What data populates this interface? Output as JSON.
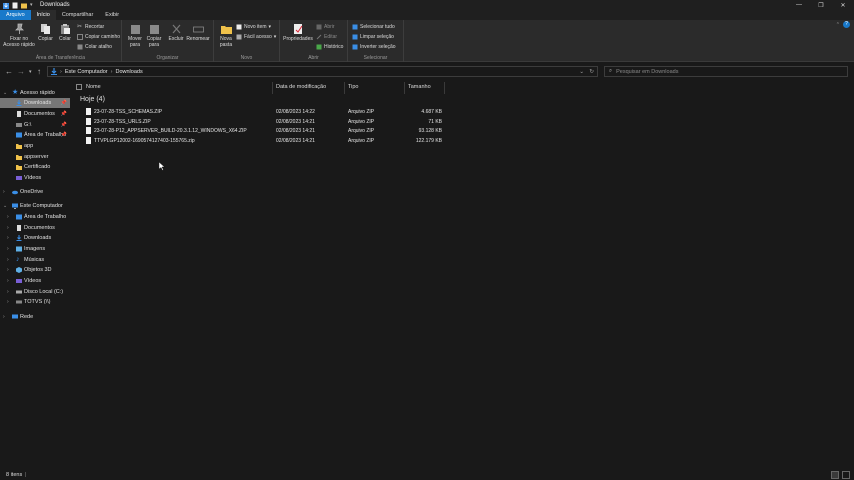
{
  "window": {
    "title": "Downloads"
  },
  "ribbon_tabs": [
    "Arquivo",
    "Início",
    "Compartilhar",
    "Exibir"
  ],
  "ribbon": {
    "clipboard": {
      "pin_label": "Fixar no Acesso rápido",
      "copy_label": "Copiar",
      "paste_label": "Colar",
      "cut_label": "Recortar",
      "copy_path_label": "Copiar caminho",
      "paste_shortcut_label": "Colar atalho",
      "group_label": "Área de Transferência"
    },
    "organize": {
      "move_label": "Mover para",
      "copy_to_label": "Copiar para",
      "delete_label": "Excluir",
      "rename_label": "Renomear",
      "group_label": "Organizar"
    },
    "new": {
      "new_folder_label": "Nova pasta",
      "new_item_label": "Novo item",
      "easy_access_label": "Fácil acesso",
      "group_label": "Novo"
    },
    "open": {
      "properties_label": "Propriedades",
      "open_label": "Abrir",
      "edit_label": "Editar",
      "history_label": "Histórico",
      "group_label": "Abrir"
    },
    "select": {
      "select_all_label": "Selecionar tudo",
      "select_none_label": "Limpar seleção",
      "invert_label": "Inverter seleção",
      "group_label": "Selecionar"
    }
  },
  "address": {
    "crumbs": [
      "Este Computador",
      "Downloads"
    ],
    "search_placeholder": "Pesquisar em Downloads"
  },
  "sidebar": {
    "quick_access": "Acesso rápido",
    "quick_items": [
      {
        "label": "Downloads",
        "pinned": true,
        "selected": true
      },
      {
        "label": "Documentos",
        "pinned": true
      },
      {
        "label": "G:\\",
        "pinned": true
      },
      {
        "label": "Área de Trabalho",
        "pinned": true
      },
      {
        "label": "app"
      },
      {
        "label": "appserver"
      },
      {
        "label": "Certificado"
      },
      {
        "label": "Vídeos"
      }
    ],
    "onedrive": "OneDrive",
    "this_pc": "Este Computador",
    "pc_items": [
      {
        "label": "Área de Trabalho"
      },
      {
        "label": "Documentos"
      },
      {
        "label": "Downloads"
      },
      {
        "label": "Imagens"
      },
      {
        "label": "Músicas"
      },
      {
        "label": "Objetos 3D"
      },
      {
        "label": "Vídeos"
      },
      {
        "label": "Disco Local (C:)"
      },
      {
        "label": "TOTVS (\\\\)"
      }
    ],
    "network": "Rede"
  },
  "columns": {
    "name": "Nome",
    "modified": "Data de modificação",
    "type": "Tipo",
    "size": "Tamanho"
  },
  "group_header": "Hoje (4)",
  "files": [
    {
      "name": "23-07-28-TSS_SCHEMAS.ZIP",
      "modified": "02/08/2023 14:22",
      "type": "Arquivo ZIP",
      "size": "4.687 KB"
    },
    {
      "name": "23-07-28-TSS_URLS.ZIP",
      "modified": "02/08/2023 14:21",
      "type": "Arquivo ZIP",
      "size": "71 KB"
    },
    {
      "name": "23-07-28-P12_APPSERVER_BUILD-20.3.1.12_WINDOWS_X64.ZIP",
      "modified": "02/08/2023 14:21",
      "type": "Arquivo ZIP",
      "size": "93.128 KB"
    },
    {
      "name": "TTVPLGP12002-1690574127403-155765.zip",
      "modified": "02/08/2023 14:21",
      "type": "Arquivo ZIP",
      "size": "122.179 KB"
    }
  ],
  "status": {
    "item_count": "8 itens"
  },
  "colors": {
    "accent": "#1979ca",
    "background": "#191919",
    "ribbon": "#2b2b2b",
    "selected": "#777777",
    "folder": "#f0c24b"
  }
}
